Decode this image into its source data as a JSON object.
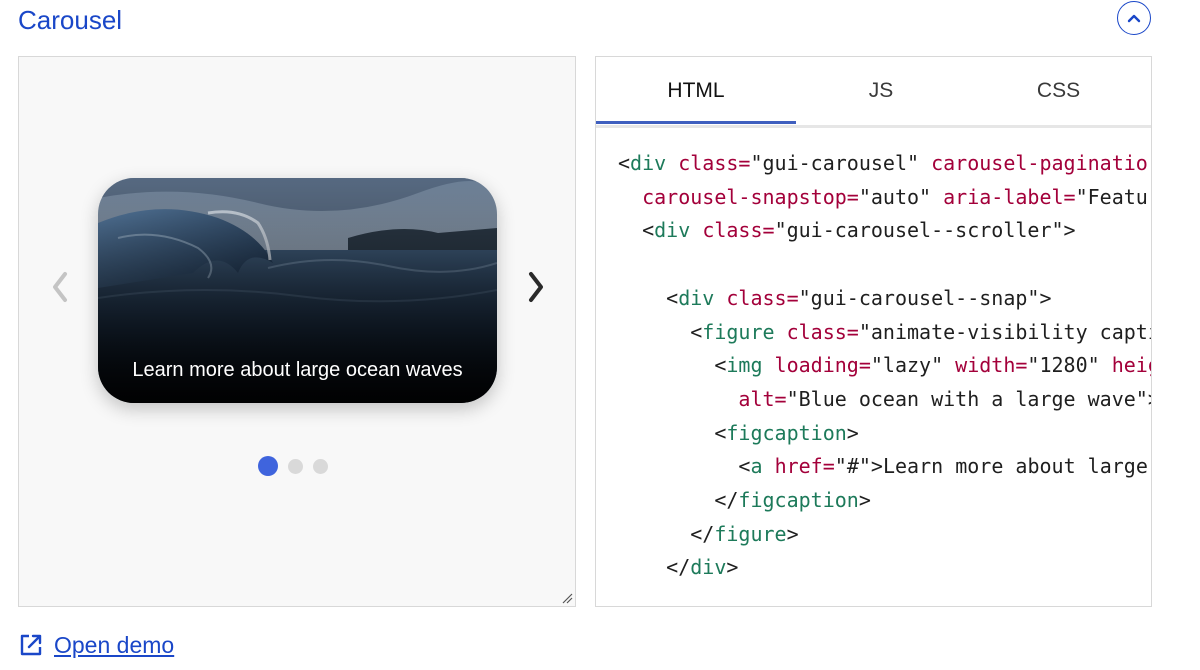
{
  "section": {
    "title": "Carousel"
  },
  "carousel": {
    "caption": "Learn more about large ocean waves",
    "image_alt": "Blue ocean with a large wave",
    "dots_count": 3,
    "active_dot": 1
  },
  "code_tabs": {
    "tabs": [
      "HTML",
      "JS",
      "CSS"
    ],
    "active": "HTML"
  },
  "code": {
    "line1": [
      "<",
      "div",
      " ",
      "class=",
      "\"gui-carousel\"",
      " ",
      "carousel-paginatio"
    ],
    "line2": [
      "  ",
      "carousel-snapstop=",
      "\"auto\"",
      " ",
      "aria-label=",
      "\"Featur"
    ],
    "line3": [
      "  ",
      "<",
      "div",
      " ",
      "class=",
      "\"gui-carousel--scroller\"",
      ">"
    ],
    "line5": [
      "    ",
      "<",
      "div",
      " ",
      "class=",
      "\"gui-carousel--snap\"",
      ">"
    ],
    "line6": [
      "      ",
      "<",
      "figure",
      " ",
      "class=",
      "\"animate-visibility capti"
    ],
    "line7": [
      "        ",
      "<",
      "img",
      " ",
      "loading=",
      "\"lazy\"",
      " ",
      "width=",
      "\"1280\"",
      " ",
      "heig"
    ],
    "line8": [
      "          ",
      "alt=",
      "\"Blue ocean with a large wave\"",
      ">"
    ],
    "line9": [
      "        ",
      "<",
      "figcaption",
      ">"
    ],
    "line10": [
      "          ",
      "<",
      "a",
      " ",
      "href=",
      "\"#\"",
      ">",
      "Learn more about large "
    ],
    "line11": [
      "        ",
      "</",
      "figcaption",
      ">"
    ],
    "line12": [
      "      ",
      "</",
      "figure",
      ">"
    ],
    "line13": [
      "    ",
      "</",
      "div",
      ">"
    ]
  },
  "footer": {
    "open_demo_label": "Open demo"
  },
  "colors": {
    "accent": "#1a47c8",
    "active_dot": "#3f64dd",
    "tag": "#1d7a5a",
    "attribute": "#a3003a"
  },
  "icons": {
    "collapse": "chevron-up-icon",
    "prev": "chevron-left-icon",
    "next": "chevron-right-icon",
    "external": "external-link-icon",
    "resize": "resize-handle-icon"
  }
}
